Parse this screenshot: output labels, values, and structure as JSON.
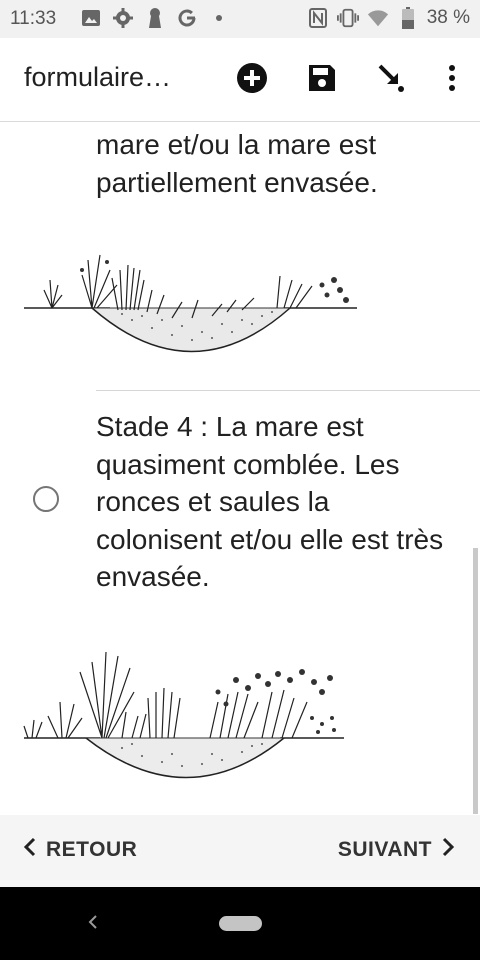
{
  "status_bar": {
    "time": "11:33",
    "battery_percent": "38 %",
    "icons_left": [
      "image-icon",
      "settings-icon",
      "keyhole-icon",
      "google-icon",
      "dot-icon"
    ],
    "icons_right": [
      "nfc-icon",
      "vibrate-icon",
      "wifi-icon",
      "battery-icon"
    ]
  },
  "app_bar": {
    "title": "formulaire…",
    "actions": [
      "add-circle-icon",
      "save-icon",
      "go-to-icon",
      "more-vert-icon"
    ]
  },
  "content": {
    "stage3_text": "mare et/ou la mare est partiellement envasée.",
    "stage4_text": "Stade 4 : La mare est quasiment comblée. Les ronces et saules la colonisent et/ou elle est très envasée."
  },
  "nav": {
    "back_label": "RETOUR",
    "next_label": "SUIVANT"
  },
  "colors": {
    "text": "#212121",
    "status_bg": "#f1f1f1",
    "nav_bg": "#f5f5f5",
    "system_nav_bg": "#000000"
  }
}
